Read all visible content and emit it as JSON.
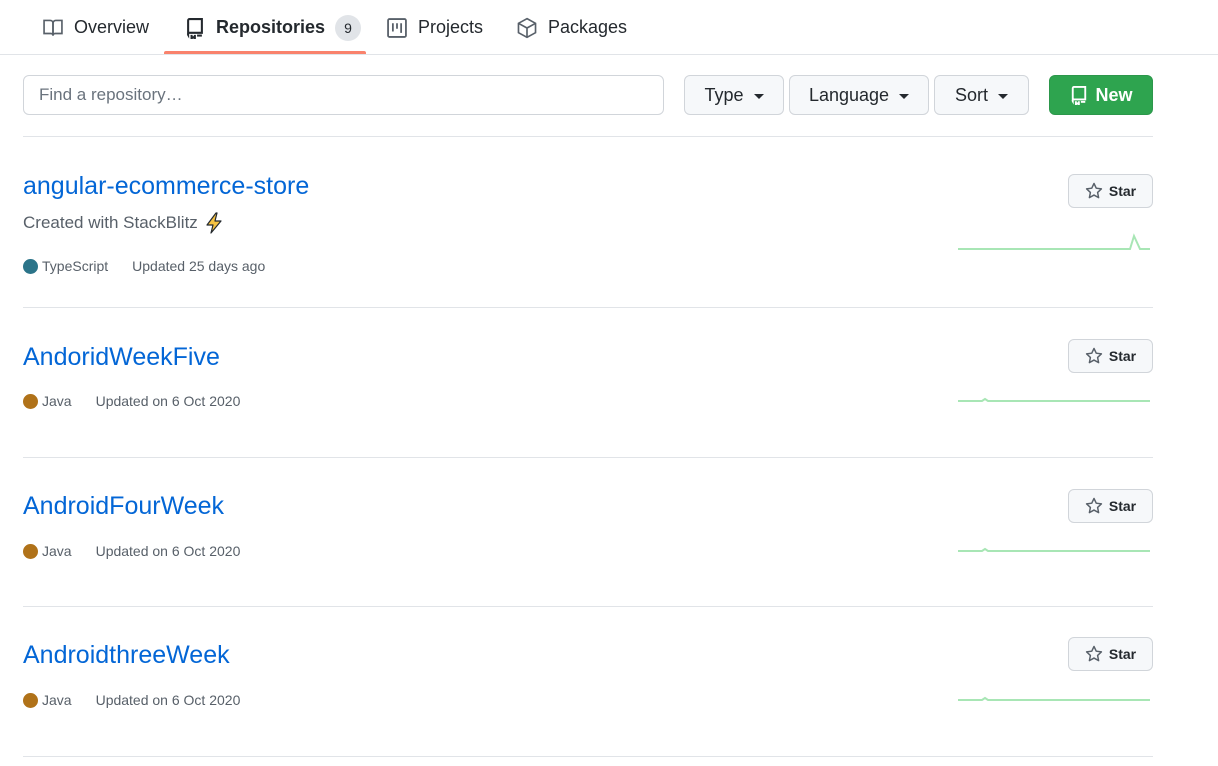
{
  "tabs": [
    {
      "label": "Overview",
      "icon": "book-icon"
    },
    {
      "label": "Repositories",
      "icon": "repo-icon",
      "count": "9",
      "active": true
    },
    {
      "label": "Projects",
      "icon": "project-icon"
    },
    {
      "label": "Packages",
      "icon": "package-icon"
    }
  ],
  "filters": {
    "search_placeholder": "Find a repository…",
    "type_label": "Type",
    "language_label": "Language",
    "sort_label": "Sort",
    "new_label": "New"
  },
  "repos": [
    {
      "name": "angular-ecommerce-store",
      "description": "Created with StackBlitz",
      "description_icon": "lightning-icon",
      "language": "TypeScript",
      "language_color": "#2b7489",
      "updated": "Updated 25 days ago",
      "star_label": "Star",
      "activity": "spike-near-end"
    },
    {
      "name": "AndoridWeekFive",
      "language": "Java",
      "language_color": "#b07219",
      "updated": "Updated on 6 Oct 2020",
      "star_label": "Star",
      "activity": "flat"
    },
    {
      "name": "AndroidFourWeek",
      "language": "Java",
      "language_color": "#b07219",
      "updated": "Updated on 6 Oct 2020",
      "star_label": "Star",
      "activity": "flat"
    },
    {
      "name": "AndroidthreeWeek",
      "language": "Java",
      "language_color": "#b07219",
      "updated": "Updated on 6 Oct 2020",
      "star_label": "Star",
      "activity": "flat"
    }
  ],
  "colors": {
    "link": "#0366d6",
    "accent_underline": "#f9826c",
    "new_button": "#2ea44f",
    "sparkline": "#a8e6b5"
  }
}
